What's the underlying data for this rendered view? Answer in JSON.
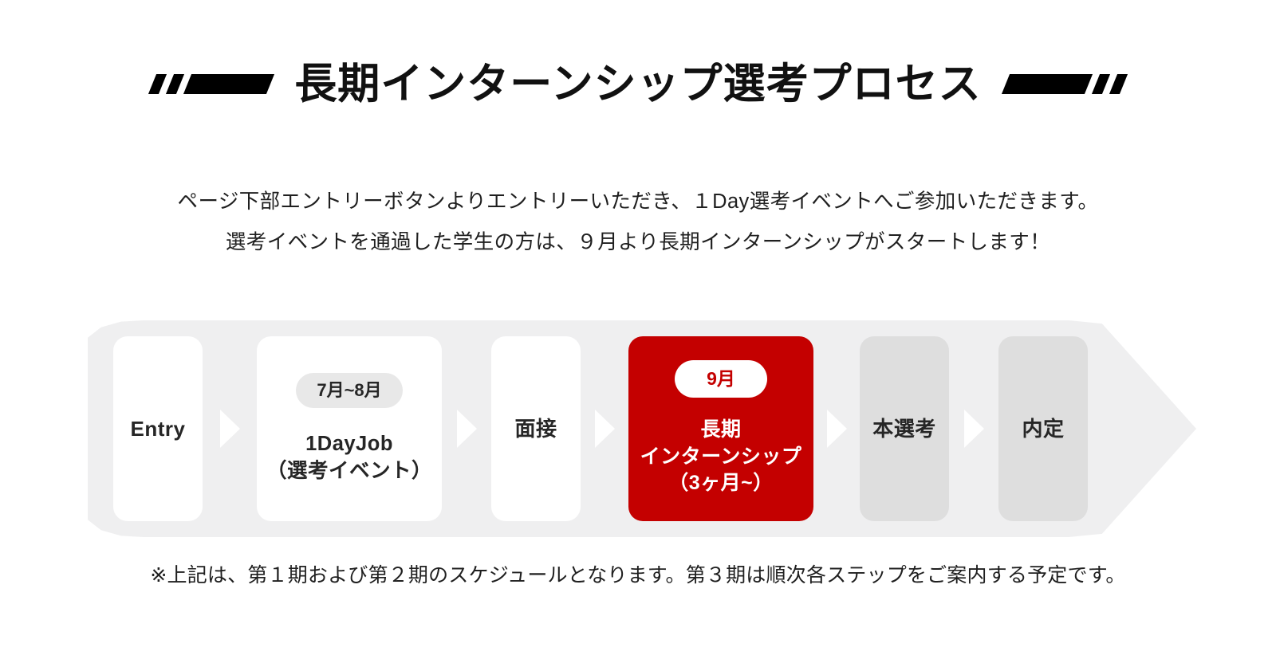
{
  "title": {
    "text": "長期インターンシップ選考プロセス",
    "left_decoration": "slanted-bars-left",
    "right_decoration": "slanted-bars-right"
  },
  "lead": {
    "line1": "ページ下部エントリーボタンよりエントリーいただき、１Day選考イベントへご参加いただきます。",
    "line2": "選考イベントを通過した学生の方は、９月より長期インターンシップがスタートします！"
  },
  "flow": {
    "steps": [
      {
        "badge": "",
        "label_line1": "Entry",
        "label_line2": "",
        "label_line3": "",
        "style": "white",
        "width": "narrow"
      },
      {
        "badge": "7月~8月",
        "label_line1": "1DayJob",
        "label_line2": "（選考イベント）",
        "label_line3": "",
        "style": "white",
        "width": "wide"
      },
      {
        "badge": "",
        "label_line1": "面接",
        "label_line2": "",
        "label_line3": "",
        "style": "white",
        "width": "narrow"
      },
      {
        "badge": "9月",
        "label_line1": "長期",
        "label_line2": "インターンシップ",
        "label_line3": "（3ヶ月~）",
        "style": "red",
        "width": "wide"
      },
      {
        "badge": "",
        "label_line1": "本選考",
        "label_line2": "",
        "label_line3": "",
        "style": "grey",
        "width": "narrow"
      },
      {
        "badge": "",
        "label_line1": "内定",
        "label_line2": "",
        "label_line3": "",
        "style": "grey",
        "width": "narrow"
      }
    ],
    "separator_icon": "triangle-right-icon"
  },
  "footnote": {
    "text": "※上記は、第１期および第２期のスケジュールとなります。第３期は順次各ステップをご案内する予定です。"
  },
  "colors": {
    "accent_red": "#C40000",
    "container_grey": "#EFEFF0",
    "card_grey": "#DEDEDE",
    "badge_grey": "#E8E8E8",
    "text": "#1F1F1F"
  }
}
